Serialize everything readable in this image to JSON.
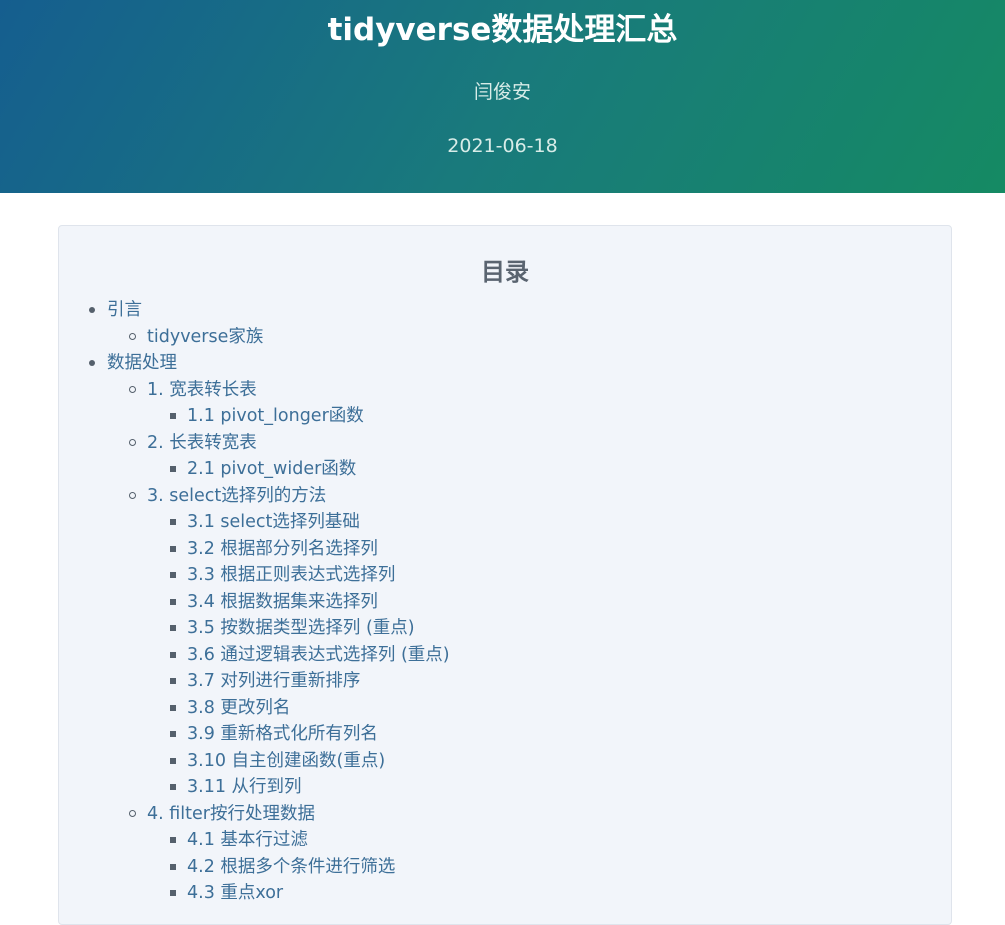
{
  "header": {
    "title": "tidyverse数据处理汇总",
    "author": "闫俊安",
    "date": "2021-06-18"
  },
  "toc": {
    "title": "目录",
    "items": [
      {
        "level": 1,
        "label": "引言"
      },
      {
        "level": 2,
        "label": "tidyverse家族"
      },
      {
        "level": 1,
        "label": "数据处理"
      },
      {
        "level": 2,
        "label": "1. 宽表转长表"
      },
      {
        "level": 3,
        "label": "1.1 pivot_longer函数"
      },
      {
        "level": 2,
        "label": "2. 长表转宽表"
      },
      {
        "level": 3,
        "label": "2.1 pivot_wider函数"
      },
      {
        "level": 2,
        "label": "3. select选择列的方法"
      },
      {
        "level": 3,
        "label": "3.1 select选择列基础"
      },
      {
        "level": 3,
        "label": "3.2 根据部分列名选择列"
      },
      {
        "level": 3,
        "label": "3.3 根据正则表达式选择列"
      },
      {
        "level": 3,
        "label": "3.4 根据数据集来选择列"
      },
      {
        "level": 3,
        "label": "3.5 按数据类型选择列 (重点)"
      },
      {
        "level": 3,
        "label": "3.6 通过逻辑表达式选择列 (重点)"
      },
      {
        "level": 3,
        "label": "3.7 对列进行重新排序"
      },
      {
        "level": 3,
        "label": "3.8 更改列名"
      },
      {
        "level": 3,
        "label": "3.9 重新格式化所有列名"
      },
      {
        "level": 3,
        "label": "3.10 自主创建函数(重点)"
      },
      {
        "level": 3,
        "label": "3.11 从行到列"
      },
      {
        "level": 2,
        "label": "4. filter按行处理数据"
      },
      {
        "level": 3,
        "label": "4.1 基本行过滤"
      },
      {
        "level": 3,
        "label": "4.2 根据多个条件进行筛选"
      },
      {
        "level": 3,
        "label": "4.3 重点xor"
      }
    ]
  }
}
